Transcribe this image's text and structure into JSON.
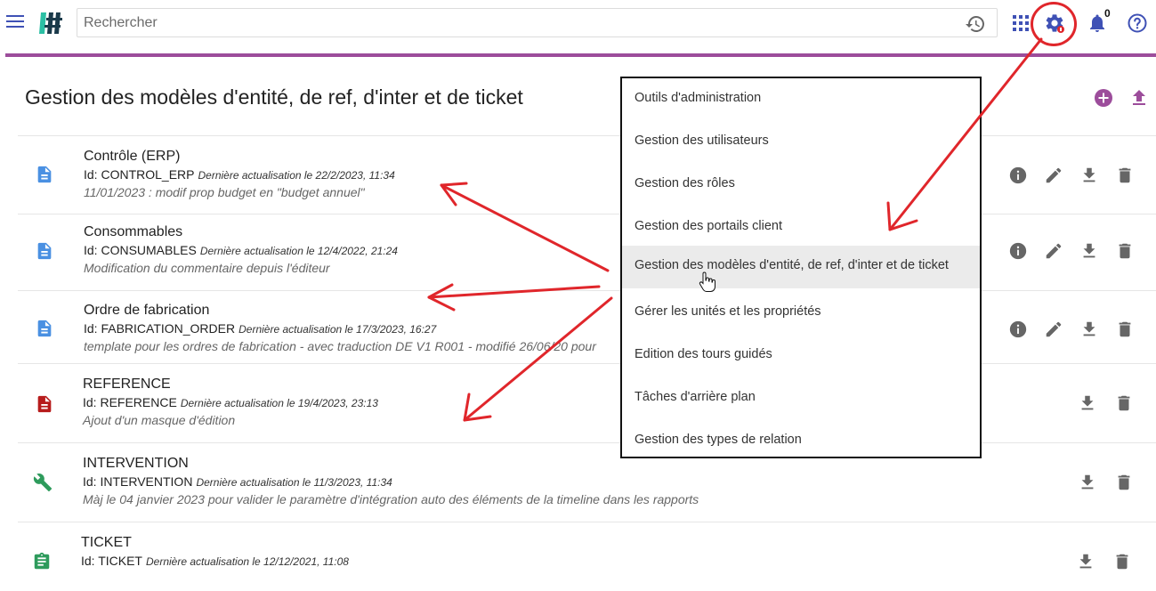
{
  "header": {
    "search_placeholder": "Rechercher",
    "notification_count": "0"
  },
  "page": {
    "title": "Gestion des modèles d'entité, de ref, d'inter et de ticket"
  },
  "models": [
    {
      "name": "Contrôle (ERP)",
      "id": "Id: CONTROL_ERP",
      "updated": "Dernière actualisation le 22/2/2023, 11:34",
      "comment": "11/01/2023 : modif prop budget en \"budget annuel\"",
      "icon": "document-icon"
    },
    {
      "name": "Consommables",
      "id": "Id: CONSUMABLES",
      "updated": "Dernière actualisation le 12/4/2022, 21:24",
      "comment": "Modification du commentaire depuis l'éditeur",
      "icon": "document-icon"
    },
    {
      "name": "Ordre de fabrication",
      "id": "Id: FABRICATION_ORDER",
      "updated": "Dernière actualisation le 17/3/2023, 16:27",
      "comment": "template pour les ordres de fabrication - avec traduction DE V1 R001 - modifié 26/06/20 pour",
      "icon": "document-icon"
    },
    {
      "name": "REFERENCE",
      "id": "Id: REFERENCE",
      "updated": "Dernière actualisation le 19/4/2023, 23:13",
      "comment": "Ajout d'un masque d'édition",
      "icon": "reference-document-icon"
    },
    {
      "name": "INTERVENTION",
      "id": "Id: INTERVENTION",
      "updated": "Dernière actualisation le 11/3/2023, 11:34",
      "comment": "Màj le 04 janvier 2023 pour valider le paramètre d'intégration auto des éléments de la timeline dans les rapports",
      "icon": "wrench-icon"
    },
    {
      "name": "TICKET",
      "id": "Id: TICKET",
      "updated": "Dernière actualisation le 12/12/2021, 11:08",
      "comment": "",
      "icon": "clipboard-icon"
    }
  ],
  "admin_menu": {
    "items": [
      "Outils d'administration",
      "Gestion des utilisateurs",
      "Gestion des rôles",
      "Gestion des portails client",
      "Gestion des modèles d'entité, de ref, d'inter et de ticket",
      "Gérer les unités et les propriétés",
      "Edition des tours guidés",
      "Tâches d'arrière plan",
      "Gestion des types de relation"
    ],
    "active_index": 4
  },
  "colors": {
    "accent": "#3f51b5",
    "purple_bar": "#9c4d9b",
    "add_button": "#9c4d9b",
    "doc_icon": "#4a90e2",
    "reference_icon": "#b71c1c",
    "wrench_icon": "#2e9b5c",
    "clipboard_icon": "#2e9b5c",
    "annotation_red": "#e0262b",
    "action_icon": "#666666"
  }
}
